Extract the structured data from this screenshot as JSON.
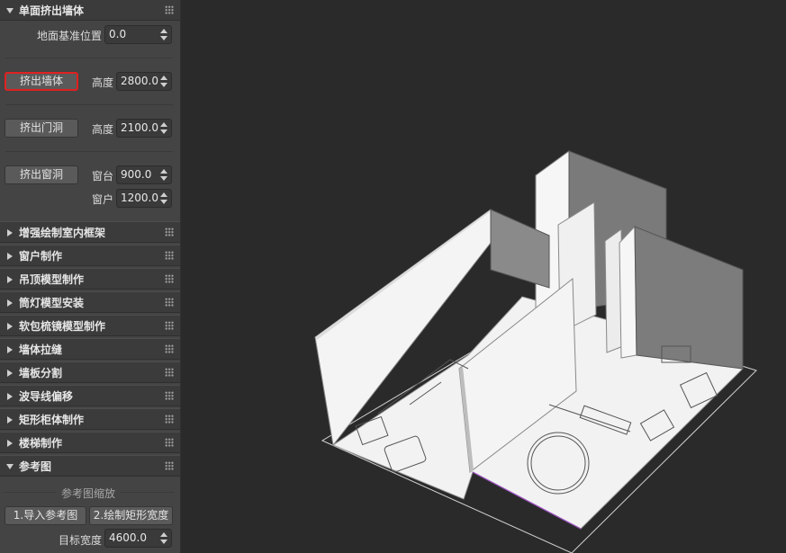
{
  "panel": {
    "section_extrude": {
      "title": "单面挤出墙体",
      "ground_label": "地面基准位置",
      "ground_value": "0.0",
      "wall_button": "挤出墙体",
      "wall_height_label": "高度",
      "wall_height_value": "2800.0",
      "door_button": "挤出门洞",
      "door_height_label": "高度",
      "door_height_value": "2100.0",
      "window_button": "挤出窗洞",
      "sill_label": "窗台",
      "sill_value": "900.0",
      "window_label": "窗户",
      "window_value": "1200.0"
    },
    "collapsed_sections": [
      "增强绘制室内框架",
      "窗户制作",
      "吊顶模型制作",
      "筒灯模型安装",
      "软包梳镜模型制作",
      "墙体拉缝",
      "墙板分割",
      "波导线偏移",
      "矩形柜体制作",
      "楼梯制作"
    ],
    "section_reference": {
      "title": "参考图",
      "zoom_label": "参考图缩放",
      "import_button": "1.导入参考图",
      "draw_button": "2.绘制矩形宽度",
      "target_width_label": "目标宽度",
      "target_width_value": "4600.0"
    }
  },
  "colors": {
    "highlight": "#e02020",
    "panel_bg": "#444444",
    "viewport_bg": "#2a2a2a"
  }
}
